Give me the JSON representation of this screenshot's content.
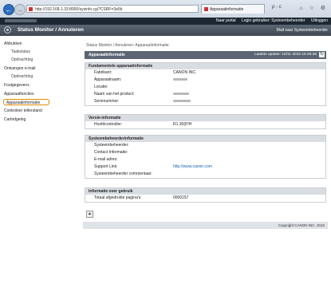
{
  "browser": {
    "url": "http://192.168.1.33:8000/sysinfo.cgi?CSRF=3a5b",
    "tab_title": "Apparaatinformatie",
    "address_tools": "ρ - c",
    "window_controls": "⌂ ☆ ⚙"
  },
  "topbar": {
    "links": [
      "Naar portal",
      "Login gebruiker: Systeembeheerder",
      "Uitloggen"
    ]
  },
  "header": {
    "title": "Status Monitor / Annuleren",
    "admin_link": "Mail naar Systeembeheerder"
  },
  "sidebar": {
    "items": [
      {
        "label": "Afdrukken",
        "sub": false
      },
      {
        "label": "Taakstatus",
        "sub": true
      },
      {
        "label": "Opdrachtlog",
        "sub": true
      },
      {
        "label": "Ontvangen e-mail",
        "sub": false
      },
      {
        "label": "Opdrachtlog",
        "sub": true
      },
      {
        "label": "Foutgegevens",
        "sub": false
      },
      {
        "label": "Apparaatfuncties",
        "sub": false
      },
      {
        "label": "Apparaatinformatie",
        "sub": false,
        "active": true
      },
      {
        "label": "Controleer teller­stand",
        "sub": false
      },
      {
        "label": "Cartridgelog",
        "sub": false
      }
    ]
  },
  "main": {
    "breadcrumb": "Status Monitor / Annuleren: Apparaatinformatie",
    "page_title": "Apparaatinformatie",
    "last_update": "Laatste update: 10/11 2015 15:29:45",
    "sections": {
      "basic": {
        "title": "Fundamentele apparaatinformatie",
        "rows": [
          {
            "label": "Fabrikant:",
            "value": "CANON INC."
          },
          {
            "label": "Apparaatnaam:",
            "value": ""
          },
          {
            "label": "Locatie:",
            "value": ""
          },
          {
            "label": "Naam van het product:",
            "value": ""
          },
          {
            "label": "Serienummer:",
            "value": ""
          }
        ]
      },
      "version": {
        "title": "Versie-informatie",
        "rows": [
          {
            "label": "Hoofdcontroller:",
            "value": "R1.30(P/H"
          }
        ]
      },
      "admin": {
        "title": "Systeembeheerderinformatie",
        "rows": [
          {
            "label": "Systeembeheerder:",
            "value": ""
          },
          {
            "label": "Contact Informatie:",
            "value": ""
          },
          {
            "label": "E-mail adres:",
            "value": ""
          },
          {
            "label": "Support Link:",
            "value": "http://www.canon.com"
          },
          {
            "label": "Systeembeheerder commentaar:",
            "value": ""
          }
        ]
      },
      "usage": {
        "title": "Informatie over gebruik",
        "rows": [
          {
            "label": "Totaal afgedrukte pagina's:",
            "value": "0000157"
          }
        ]
      }
    }
  },
  "footer": {
    "copyright": "Copyright CANON INC. 2015"
  }
}
